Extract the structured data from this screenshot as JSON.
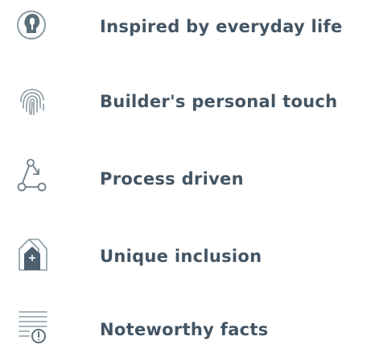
{
  "features": [
    {
      "label": "Inspired by everyday life",
      "icon": "lightbulb-head-icon"
    },
    {
      "label": "Builder's personal touch",
      "icon": "fingerprint-icon"
    },
    {
      "label": "Process driven",
      "icon": "process-flow-icon"
    },
    {
      "label": "Unique inclusion",
      "icon": "house-plus-icon"
    },
    {
      "label": "Noteworthy facts",
      "icon": "document-alert-icon"
    }
  ],
  "colors": {
    "text": "#435564",
    "icon_stroke": "#8a9aa3",
    "icon_fill": "#5c6e7a"
  }
}
